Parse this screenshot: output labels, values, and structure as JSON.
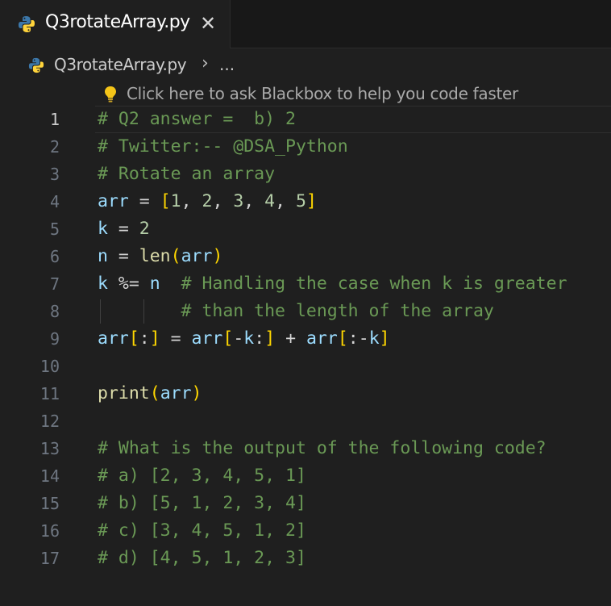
{
  "tab": {
    "title": "Q3rotateArray.py",
    "close_glyph": "✕",
    "icon": "python-icon"
  },
  "breadcrumb": {
    "file": "Q3rotateArray.py",
    "separator": "›",
    "more": "..."
  },
  "hint": {
    "text": "Click here to ask Blackbox to help you code faster",
    "icon": "lightbulb-icon"
  },
  "editor": {
    "active_line": 1,
    "lines": [
      {
        "number": "1",
        "tokens": [
          {
            "t": "# Q2 answer =  b) 2",
            "k": "c"
          }
        ]
      },
      {
        "number": "2",
        "tokens": [
          {
            "t": "# Twitter:-- @DSA_Python",
            "k": "c"
          }
        ]
      },
      {
        "number": "3",
        "tokens": [
          {
            "t": "# Rotate an array",
            "k": "c"
          }
        ]
      },
      {
        "number": "4",
        "tokens": [
          {
            "t": "arr",
            "k": "v"
          },
          {
            "t": " = ",
            "k": "o"
          },
          {
            "t": "[",
            "k": "b1"
          },
          {
            "t": "1",
            "k": "n"
          },
          {
            "t": ", ",
            "k": "o"
          },
          {
            "t": "2",
            "k": "n"
          },
          {
            "t": ", ",
            "k": "o"
          },
          {
            "t": "3",
            "k": "n"
          },
          {
            "t": ", ",
            "k": "o"
          },
          {
            "t": "4",
            "k": "n"
          },
          {
            "t": ", ",
            "k": "o"
          },
          {
            "t": "5",
            "k": "n"
          },
          {
            "t": "]",
            "k": "b1"
          }
        ]
      },
      {
        "number": "5",
        "tokens": [
          {
            "t": "k",
            "k": "v"
          },
          {
            "t": " = ",
            "k": "o"
          },
          {
            "t": "2",
            "k": "n"
          }
        ]
      },
      {
        "number": "6",
        "tokens": [
          {
            "t": "n",
            "k": "v"
          },
          {
            "t": " = ",
            "k": "o"
          },
          {
            "t": "len",
            "k": "f"
          },
          {
            "t": "(",
            "k": "b1"
          },
          {
            "t": "arr",
            "k": "v"
          },
          {
            "t": ")",
            "k": "b1"
          }
        ]
      },
      {
        "number": "7",
        "tokens": [
          {
            "t": "k",
            "k": "v"
          },
          {
            "t": " %= ",
            "k": "o"
          },
          {
            "t": "n",
            "k": "v"
          },
          {
            "t": "  # Handling the case when k is greater",
            "k": "c"
          }
        ]
      },
      {
        "number": "8",
        "tokens": [
          {
            "t": "        # than the length of the array",
            "k": "c"
          }
        ]
      },
      {
        "number": "9",
        "tokens": [
          {
            "t": "arr",
            "k": "v"
          },
          {
            "t": "[",
            "k": "b1"
          },
          {
            "t": ":",
            "k": "o"
          },
          {
            "t": "]",
            "k": "b1"
          },
          {
            "t": " = ",
            "k": "o"
          },
          {
            "t": "arr",
            "k": "v"
          },
          {
            "t": "[",
            "k": "b1"
          },
          {
            "t": "-",
            "k": "o"
          },
          {
            "t": "k",
            "k": "v"
          },
          {
            "t": ":",
            "k": "o"
          },
          {
            "t": "]",
            "k": "b1"
          },
          {
            "t": " + ",
            "k": "o"
          },
          {
            "t": "arr",
            "k": "v"
          },
          {
            "t": "[",
            "k": "b1"
          },
          {
            "t": ":-",
            "k": "o"
          },
          {
            "t": "k",
            "k": "v"
          },
          {
            "t": "]",
            "k": "b1"
          }
        ]
      },
      {
        "number": "10",
        "tokens": []
      },
      {
        "number": "11",
        "tokens": [
          {
            "t": "print",
            "k": "f"
          },
          {
            "t": "(",
            "k": "b1"
          },
          {
            "t": "arr",
            "k": "v"
          },
          {
            "t": ")",
            "k": "b1"
          }
        ]
      },
      {
        "number": "12",
        "tokens": []
      },
      {
        "number": "13",
        "tokens": [
          {
            "t": "# What is the output of the following code?",
            "k": "c"
          }
        ]
      },
      {
        "number": "14",
        "tokens": [
          {
            "t": "# a) [2, 3, 4, 5, 1]",
            "k": "c"
          }
        ]
      },
      {
        "number": "15",
        "tokens": [
          {
            "t": "# b) [5, 1, 2, 3, 4]",
            "k": "c"
          }
        ]
      },
      {
        "number": "16",
        "tokens": [
          {
            "t": "# c) [3, 4, 5, 1, 2]",
            "k": "c"
          }
        ]
      },
      {
        "number": "17",
        "tokens": [
          {
            "t": "# d) [4, 5, 1, 2, 3]",
            "k": "c"
          }
        ]
      }
    ]
  },
  "colors": {
    "background": "#1f1f1f",
    "comment": "#6a9955",
    "variable": "#9cdcfe",
    "number": "#b5cea8",
    "function": "#dcdcaa",
    "bracket": "#ffd700",
    "python_blue": "#3c78aa",
    "python_yellow": "#ffd43b"
  }
}
